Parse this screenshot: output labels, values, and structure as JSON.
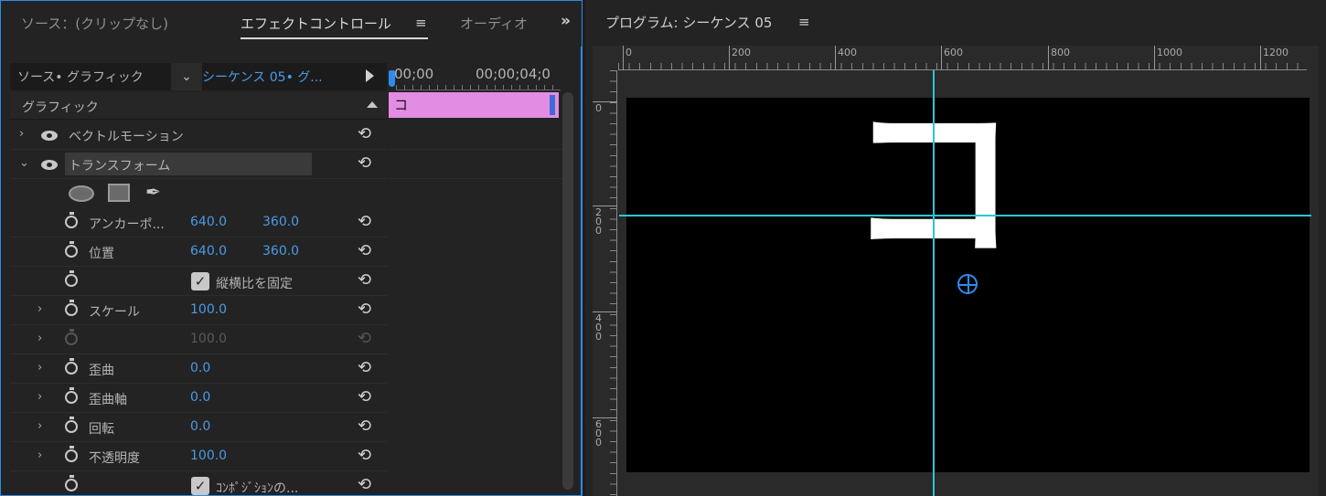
{
  "left_tabs": {
    "source": "ソース：(クリップなし)",
    "effect_controls": "エフェクトコントロール",
    "audio": "オーディオ",
    "menu_icon": "hamburger-icon",
    "overflow_icon": "double-chevron-right-icon"
  },
  "breadcrumb": {
    "source": "ソース• グラフィック",
    "sequence": "シーケンス 05• グ...",
    "timecode_start": "00;00",
    "timecode_end": "00;00;04;0"
  },
  "section": {
    "title": "グラフィック"
  },
  "properties": {
    "vector_motion": "ベクトルモーション",
    "transform": "トランスフォーム",
    "anchor_point": {
      "label": "アンカーポ...",
      "x": "640.0",
      "y": "360.0"
    },
    "position": {
      "label": "位置",
      "x": "640.0",
      "y": "360.0"
    },
    "lock_aspect": {
      "label": "縦横比を固定",
      "checked": true
    },
    "scale": {
      "label": "スケール",
      "value": "100.0"
    },
    "scale_width": {
      "value": "100.0"
    },
    "skew": {
      "label": "歪曲",
      "value": "0.0"
    },
    "skew_axis": {
      "label": "歪曲軸",
      "value": "0.0"
    },
    "rotation": {
      "label": "回転",
      "value": "0.0"
    },
    "opacity": {
      "label": "不透明度",
      "value": "100.0"
    },
    "composition": {
      "label": "ｺﾝﾎﾟｼﾞｼｮﾝの...",
      "checked": true
    }
  },
  "clip": {
    "label": "コ",
    "color": "#e38ce3"
  },
  "program": {
    "title": "プログラム: シーケンス 05",
    "menu_icon": "hamburger-icon",
    "h_ruler_labels": [
      "0",
      "200",
      "400",
      "600",
      "800",
      "1000",
      "1200"
    ],
    "v_ruler_labels": [
      "0",
      "200",
      "400",
      "600"
    ],
    "canvas_text": "コ",
    "guide_color": "#2bc6d6",
    "accent_color": "#2d8ceb"
  }
}
